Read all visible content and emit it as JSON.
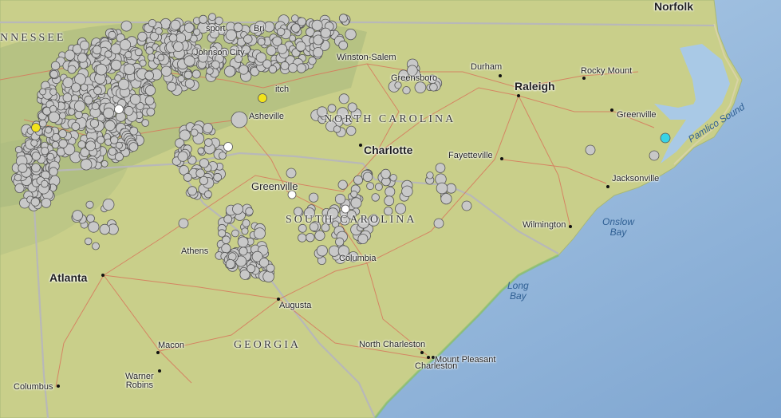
{
  "map": {
    "colors": {
      "land": "#c9cf8a",
      "ocean": "#a9c9e6",
      "deep_ocean": "#8fb3d9",
      "road": "#d7785c",
      "state_border": "#b5b5b5",
      "quake_default": "#c8c8c8",
      "quake_white": "#ffffff",
      "quake_yellow": "#f2e31b",
      "quake_cyan": "#37d3e6"
    },
    "states": [
      {
        "id": "tn",
        "label": "NNESSEE"
      },
      {
        "id": "nc",
        "label": "NORTH CAROLINA"
      },
      {
        "id": "sc",
        "label": "SOUTH CAROLINA"
      },
      {
        "id": "ga",
        "label": "GEORGIA"
      }
    ],
    "water": [
      {
        "id": "pamlico",
        "label": "Pamlico Sound"
      },
      {
        "id": "onslow",
        "label": "Onslow\nBay"
      },
      {
        "id": "long",
        "label": "Long\nBay"
      }
    ],
    "cities": [
      {
        "id": "norfolk",
        "label": "Norfolk",
        "major": true
      },
      {
        "id": "raleigh",
        "label": "Raleigh",
        "major": true
      },
      {
        "id": "charlotte",
        "label": "Charlotte",
        "major": true
      },
      {
        "id": "atlanta",
        "label": "Atlanta",
        "major": true
      },
      {
        "id": "winston",
        "label": "Winston-Salem",
        "major": false
      },
      {
        "id": "greensboro",
        "label": "Greensboro",
        "major": false
      },
      {
        "id": "durham",
        "label": "Durham",
        "major": false
      },
      {
        "id": "rockymount",
        "label": "Rocky Mount",
        "major": false
      },
      {
        "id": "greenville_nc",
        "label": "Greenville",
        "major": false
      },
      {
        "id": "jacksonville",
        "label": "Jacksonville",
        "major": false
      },
      {
        "id": "fayetteville",
        "label": "Fayetteville",
        "major": false
      },
      {
        "id": "wilmington",
        "label": "Wilmington",
        "major": false
      },
      {
        "id": "asheville",
        "label": "Asheville",
        "major": false
      },
      {
        "id": "greenville_sc",
        "label": "Greenville",
        "major": false
      },
      {
        "id": "columbia",
        "label": "Columbia",
        "major": false
      },
      {
        "id": "athens",
        "label": "Athens",
        "major": false
      },
      {
        "id": "augusta",
        "label": "Augusta",
        "major": false
      },
      {
        "id": "macon",
        "label": "Macon",
        "major": false
      },
      {
        "id": "warner",
        "label": "Warner\nRobins",
        "major": false
      },
      {
        "id": "columbus",
        "label": "Columbus",
        "major": false
      },
      {
        "id": "ncharleston",
        "label": "North Charleston",
        "major": false
      },
      {
        "id": "charleston",
        "label": "Charleston",
        "major": false
      },
      {
        "id": "mtpleasant",
        "label": "Mount Pleasant",
        "major": false
      },
      {
        "id": "johnson",
        "label": "Johnson City",
        "major": false
      },
      {
        "id": "kingsport",
        "label": "sport",
        "major": false
      },
      {
        "id": "bristol",
        "label": "Bri",
        "major": false
      },
      {
        "id": "morganton",
        "label": "itch",
        "major": false
      }
    ],
    "earthquakes": {
      "highlight": [
        {
          "color": "yellow",
          "region": "west-tn"
        },
        {
          "color": "yellow",
          "region": "nc-mountains"
        },
        {
          "color": "cyan",
          "region": "nc-coast"
        },
        {
          "color": "white",
          "region": "tn-valley"
        },
        {
          "color": "white",
          "region": "sc-upstate"
        },
        {
          "color": "white",
          "region": "sc-midlands"
        }
      ]
    }
  }
}
